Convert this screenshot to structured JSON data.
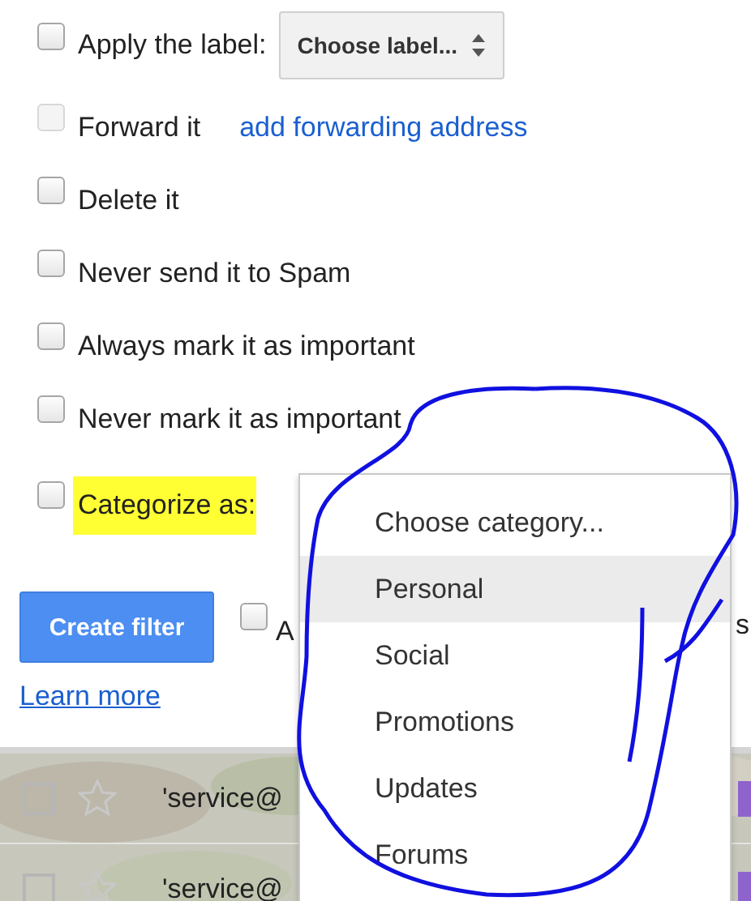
{
  "actions": [
    {
      "kind": "select",
      "label": "Apply the label:",
      "checked": false,
      "disabled": false,
      "highlighted": false,
      "select": "Choose label..."
    },
    {
      "kind": "link",
      "label": "Forward it",
      "checked": false,
      "disabled": true,
      "highlighted": false,
      "link": "add forwarding address"
    },
    {
      "kind": "plain",
      "label": "Delete it",
      "checked": false,
      "disabled": false,
      "highlighted": false
    },
    {
      "kind": "plain",
      "label": "Never send it to Spam",
      "checked": false,
      "disabled": false,
      "highlighted": false
    },
    {
      "kind": "plain",
      "label": "Always mark it as important",
      "checked": false,
      "disabled": false,
      "highlighted": false
    },
    {
      "kind": "plain",
      "label": "Never mark it as important",
      "checked": false,
      "disabled": false,
      "highlighted": false
    },
    {
      "kind": "category",
      "label": "Categorize as:",
      "checked": false,
      "disabled": false,
      "highlighted": true
    }
  ],
  "create_button": "Create filter",
  "also_apply": {
    "checked": false,
    "label_start": "A",
    "label_end": "s"
  },
  "learn_more": "Learn more",
  "category_menu": {
    "items": [
      {
        "label": "Choose category...",
        "selected": false
      },
      {
        "label": "Personal",
        "selected": true
      },
      {
        "label": "Social",
        "selected": false
      },
      {
        "label": "Promotions",
        "selected": false
      },
      {
        "label": "Updates",
        "selected": false
      },
      {
        "label": "Forums",
        "selected": false
      }
    ]
  },
  "emails": [
    {
      "checked": false,
      "starred": false,
      "sender": "'service@",
      "color": "#8e63ce"
    },
    {
      "checked": false,
      "starred": false,
      "sender": "'service@",
      "color": "#8e63ce"
    }
  ]
}
